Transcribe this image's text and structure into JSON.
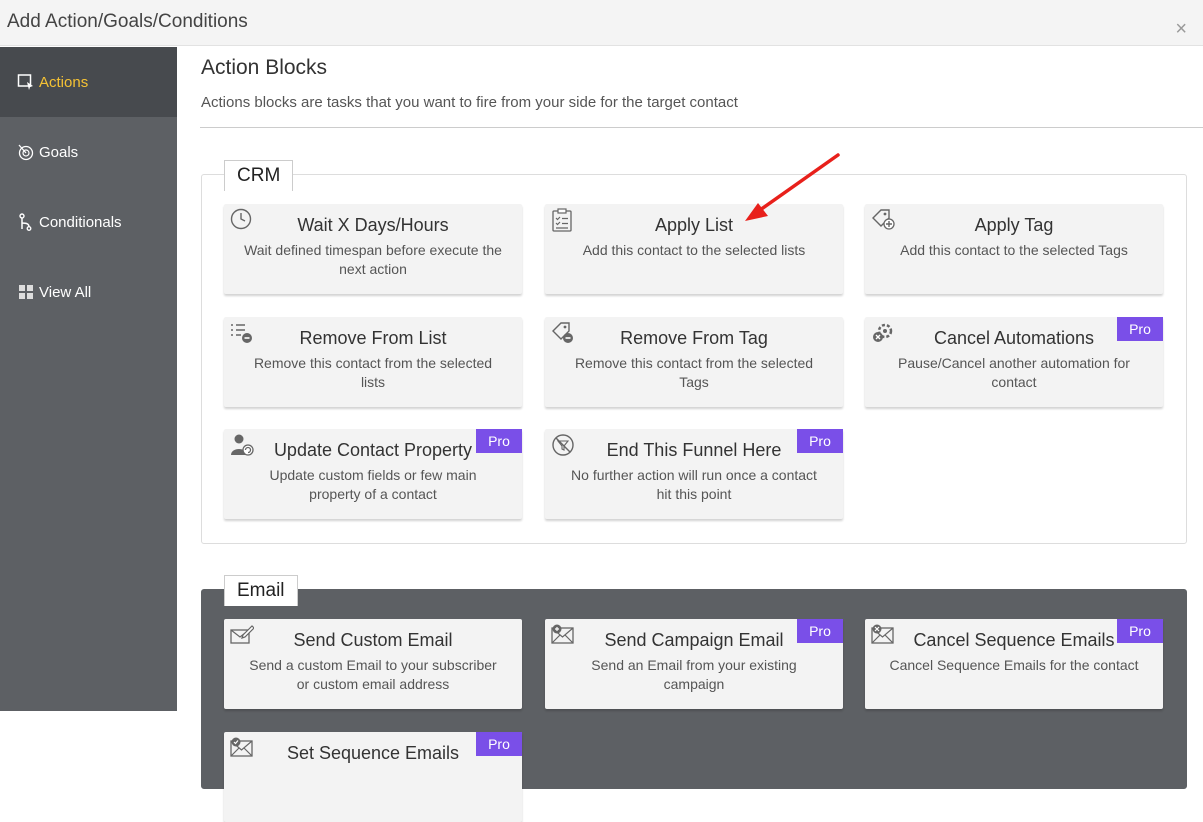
{
  "window": {
    "title": "Add Action/Goals/Conditions",
    "close_glyph": "×"
  },
  "sidebar": {
    "items": [
      {
        "label": "Actions",
        "icon": "action-icon",
        "active": true
      },
      {
        "label": "Goals",
        "icon": "goal-icon",
        "active": false
      },
      {
        "label": "Conditionals",
        "icon": "conditional-icon",
        "active": false
      },
      {
        "label": "View All",
        "icon": "grid-icon",
        "active": false
      }
    ]
  },
  "main": {
    "heading": "Action Blocks",
    "subheading": "Actions blocks are tasks that you want to fire from your side for the target contact"
  },
  "sections": {
    "crm": {
      "label": "CRM",
      "cards": [
        {
          "title": "Wait X Days/Hours",
          "desc": "Wait defined timespan before execute the next action",
          "icon": "clock-icon"
        },
        {
          "title": "Apply List",
          "desc": "Add this contact to the selected lists",
          "icon": "clipboard-list-icon"
        },
        {
          "title": "Apply Tag",
          "desc": "Add this contact to the selected Tags",
          "icon": "tag-plus-icon"
        },
        {
          "title": "Remove From List",
          "desc": "Remove this contact from the selected lists",
          "icon": "list-remove-icon"
        },
        {
          "title": "Remove From Tag",
          "desc": "Remove this contact from the selected Tags",
          "icon": "tag-remove-icon"
        },
        {
          "title": "Cancel Automations",
          "desc": "Pause/Cancel another automation for contact",
          "icon": "cancel-automation-icon",
          "badge": "Pro"
        },
        {
          "title": "Update Contact Property",
          "desc": "Update custom fields or few main property of a contact",
          "icon": "user-update-icon",
          "badge": "Pro"
        },
        {
          "title": "End This Funnel Here",
          "desc": "No further action will run once a contact hit this point",
          "icon": "stop-funnel-icon",
          "badge": "Pro"
        }
      ]
    },
    "email": {
      "label": "Email",
      "cards": [
        {
          "title": "Send Custom Email",
          "desc": "Send a custom Email to your subscriber or custom email address",
          "icon": "email-edit-icon"
        },
        {
          "title": "Send Campaign Email",
          "desc": "Send an Email from your existing campaign",
          "icon": "email-campaign-icon",
          "badge": "Pro"
        },
        {
          "title": "Cancel Sequence Emails",
          "desc": "Cancel Sequence Emails for the contact",
          "icon": "email-cancel-icon",
          "badge": "Pro"
        },
        {
          "title": "Set Sequence Emails",
          "desc": "",
          "icon": "email-sequence-icon",
          "badge": "Pro"
        }
      ]
    }
  },
  "colors": {
    "sidebar_bg": "#5d6064",
    "sidebar_active_bg": "#474a4e",
    "active_text": "#f5c234",
    "pro_badge": "#7a4fe8",
    "annotation_arrow": "#e8201b"
  }
}
